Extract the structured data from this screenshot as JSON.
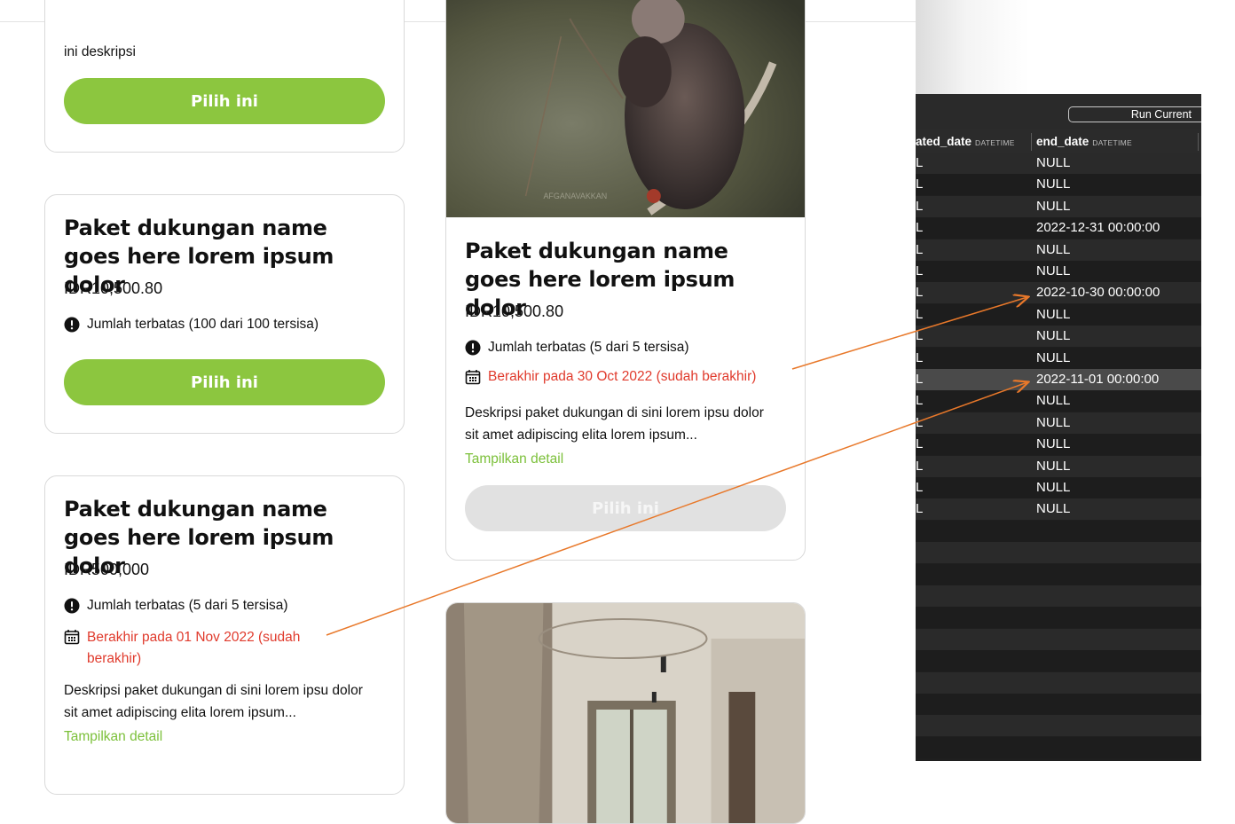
{
  "cards": {
    "card1": {
      "description": "ini deskripsi",
      "button": "Pilih ini"
    },
    "card2": {
      "title": "Paket dukungan name goes here lorem ipsum dolor",
      "price": "IDR10,500.80",
      "quota": "Jumlah terbatas (100 dari 100 tersisa)",
      "button": "Pilih ini"
    },
    "card3": {
      "title": "Paket dukungan name goes here lorem ipsum dolor",
      "price": "IDR500,000",
      "quota": "Jumlah terbatas (5 dari 5 tersisa)",
      "ended": "Berakhir pada 01 Nov 2022 (sudah berakhir)",
      "description": "Deskripsi paket dukungan di sini lorem ipsu dolor sit amet adipiscing elita lorem ipsum...",
      "detail_link": "Tampilkan detail"
    },
    "card4": {
      "image_watermark": "AFGANAVAKKAN",
      "title": "Paket dukungan name goes here lorem ipsum dolor",
      "price": "IDR10,500.80",
      "quota": "Jumlah terbatas (5 dari 5 tersisa)",
      "ended": "Berakhir pada 30 Oct 2022 (sudah berakhir)",
      "description": "Deskripsi paket dukungan di sini lorem ipsu dolor sit amet adipiscing elita lorem ipsum...",
      "detail_link": "Tampilkan detail",
      "button": "Pilih ini"
    }
  },
  "icons": {
    "quota": "exclamation-circle-icon",
    "ended": "calendar-icon"
  },
  "colors": {
    "accent_green": "#8cc63f",
    "link_green": "#7cc03a",
    "danger_red": "#e03a2c",
    "disabled_gray": "#e1e1e1",
    "arrow_orange": "#e8782a"
  },
  "db": {
    "run_button": "Run Current",
    "columns": [
      {
        "name": "ated_date",
        "type": "DATETIME"
      },
      {
        "name": "end_date",
        "type": "DATETIME"
      }
    ],
    "rows": [
      [
        "L",
        "NULL"
      ],
      [
        "L",
        "NULL"
      ],
      [
        "L",
        "NULL"
      ],
      [
        "L",
        "2022-12-31 00:00:00"
      ],
      [
        "L",
        "NULL"
      ],
      [
        "L",
        "NULL"
      ],
      [
        "L",
        "2022-10-30 00:00:00"
      ],
      [
        "L",
        "NULL"
      ],
      [
        "L",
        "NULL"
      ],
      [
        "L",
        "NULL"
      ],
      [
        "L",
        "2022-11-01 00:00:00"
      ],
      [
        "L",
        "NULL"
      ],
      [
        "L",
        "NULL"
      ],
      [
        "L",
        "NULL"
      ],
      [
        "L",
        "NULL"
      ],
      [
        "L",
        "NULL"
      ],
      [
        "L",
        "NULL"
      ]
    ],
    "selected_row": 10
  }
}
